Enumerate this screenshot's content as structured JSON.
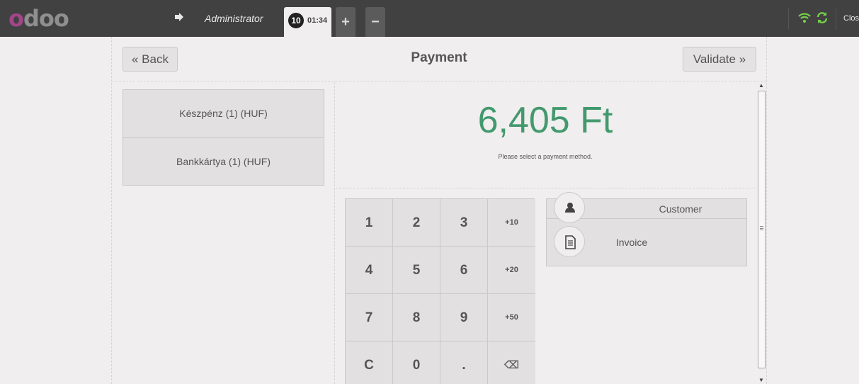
{
  "topbar": {
    "logo_first": "o",
    "logo_rest": "doo",
    "user": "Administrator",
    "order_number": "10",
    "order_time": "01:34",
    "add_tab": "+",
    "remove_tab": "−",
    "close_label": "Close",
    "connection_color": "#76d14a"
  },
  "payment": {
    "title": "Payment",
    "back_label": "« Back",
    "validate_label": "Validate »",
    "methods": [
      "Készpénz (1) (HUF)",
      "Bankkártya (1) (HUF)"
    ],
    "total": "6,405 Ft",
    "hint": "Please select a payment method.",
    "numpad": {
      "keys": [
        "1",
        "2",
        "3",
        "+10",
        "4",
        "5",
        "6",
        "+20",
        "7",
        "8",
        "9",
        "+50",
        "C",
        "0",
        ".",
        "⌫"
      ]
    },
    "customer_label": "Customer",
    "invoice_label": "Invoice",
    "total_color": "#43996e"
  }
}
